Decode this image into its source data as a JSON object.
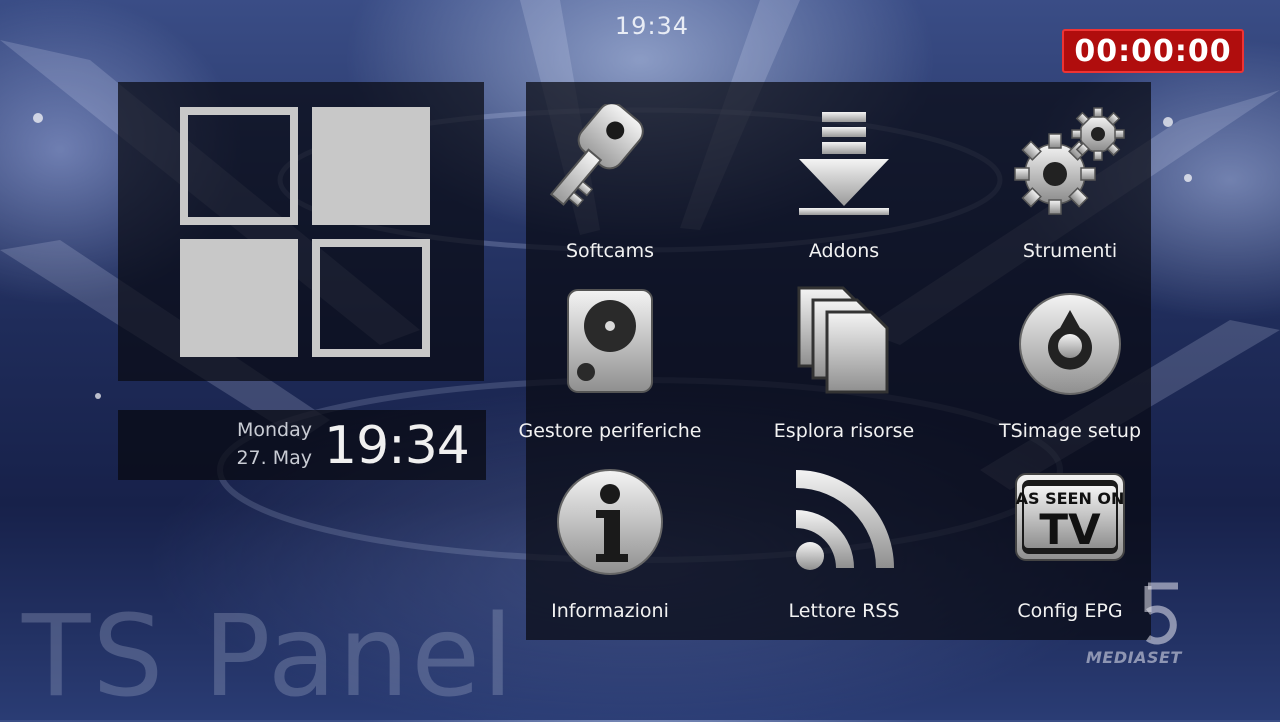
{
  "status_bar": {
    "clock": "19:34"
  },
  "recording_timer": "00:00:00",
  "datetime_widget": {
    "day": "Monday",
    "date": "27. May",
    "time": "19:34"
  },
  "menu": {
    "items": [
      {
        "label": "Softcams",
        "icon": "key-icon"
      },
      {
        "label": "Addons",
        "icon": "download-icon"
      },
      {
        "label": "Strumenti",
        "icon": "gears-icon"
      },
      {
        "label": "Gestore periferiche",
        "icon": "hard-drive-icon"
      },
      {
        "label": "Esplora risorse",
        "icon": "files-icon"
      },
      {
        "label": "TSimage setup",
        "icon": "dial-icon"
      },
      {
        "label": "Informazioni",
        "icon": "info-icon"
      },
      {
        "label": "Lettore RSS",
        "icon": "rss-icon"
      },
      {
        "label": "Config EPG",
        "icon": "as-seen-on-tv-icon",
        "icon_text_top": "AS SEEN ON",
        "icon_text_main": "TV"
      }
    ]
  },
  "panel_title": "TS Panel",
  "channel_logo": {
    "text": "MEDIASET"
  },
  "colors": {
    "panel_bg": "#0a0c14",
    "tile": "#c8c8c8",
    "timer_bg": "#b00d0d",
    "icon_metal": "#d9d9d9"
  }
}
